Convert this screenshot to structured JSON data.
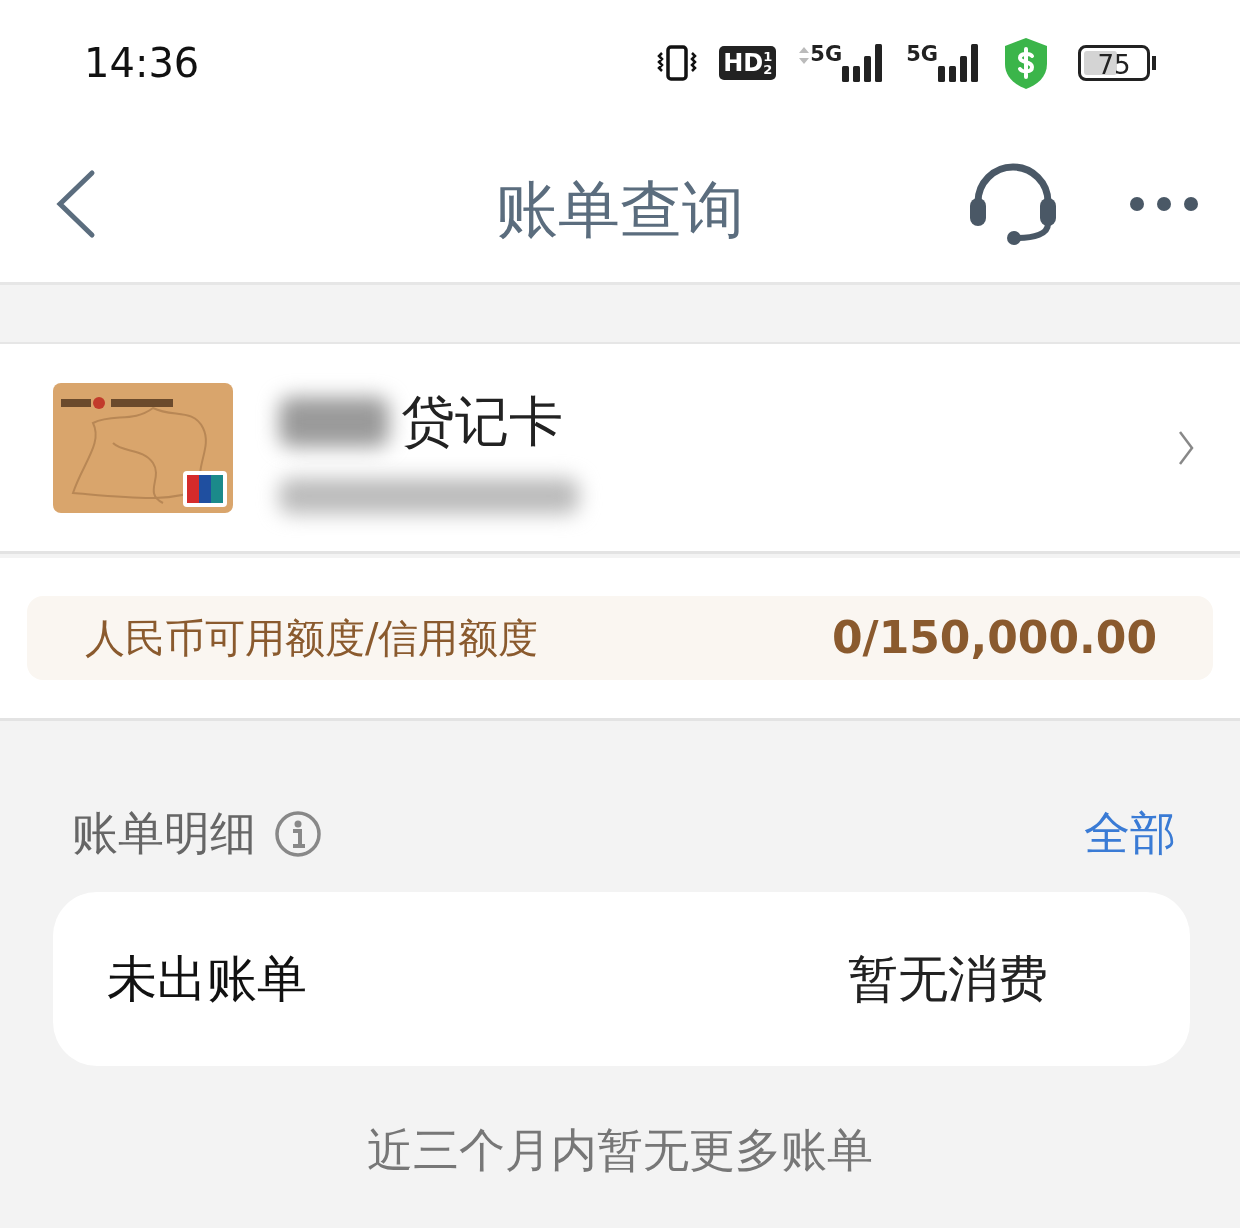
{
  "status_bar": {
    "time": "14:36",
    "hd": {
      "label": "HD",
      "sup": "1",
      "sub": "2"
    },
    "networks": [
      {
        "label": "5G",
        "data_arrows": true
      },
      {
        "label": "5G",
        "data_arrows": false
      }
    ],
    "battery": "75"
  },
  "nav": {
    "title": "账单查询"
  },
  "card": {
    "name": "贷记卡",
    "name_redacted": true,
    "number_redacted": true
  },
  "limit": {
    "label": "人民币可用额度/信用额度",
    "value": "0/150,000.00"
  },
  "bills": {
    "title": "账单明细",
    "all_link": "全部",
    "rows": [
      {
        "label": "未出账单",
        "value": "暂无消费"
      }
    ],
    "footer": "近三个月内暂无更多账单"
  }
}
